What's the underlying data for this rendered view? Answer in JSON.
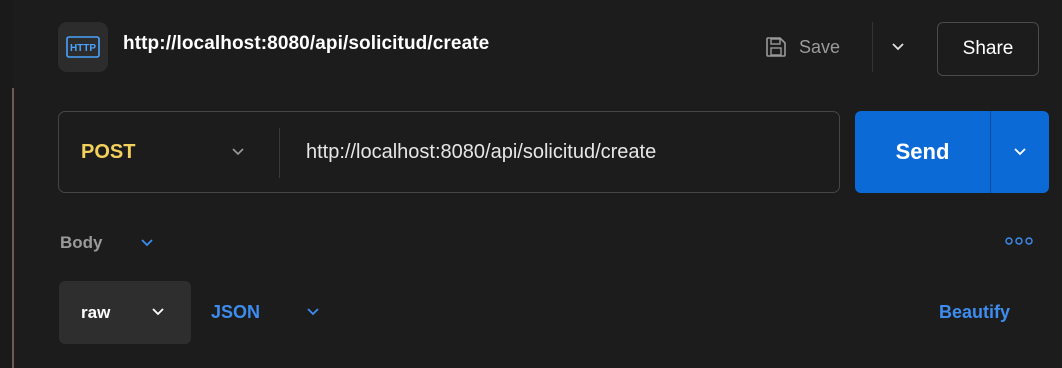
{
  "request": {
    "icon": "http-file-icon",
    "icon_text": "HTTP",
    "title": "http://localhost:8080/api/solicitud/create"
  },
  "toolbar": {
    "save_label": "Save",
    "share_label": "Share"
  },
  "url_bar": {
    "method": "POST",
    "url": "http://localhost:8080/api/solicitud/create",
    "send_label": "Send"
  },
  "body_section": {
    "label": "Body",
    "format_mode": "raw",
    "language": "JSON",
    "beautify_label": "Beautify"
  },
  "colors": {
    "background": "#1c1c1c",
    "method_post": "#f1d15b",
    "send_button": "#0c6ad6",
    "link_accent": "#3d8cf0"
  }
}
